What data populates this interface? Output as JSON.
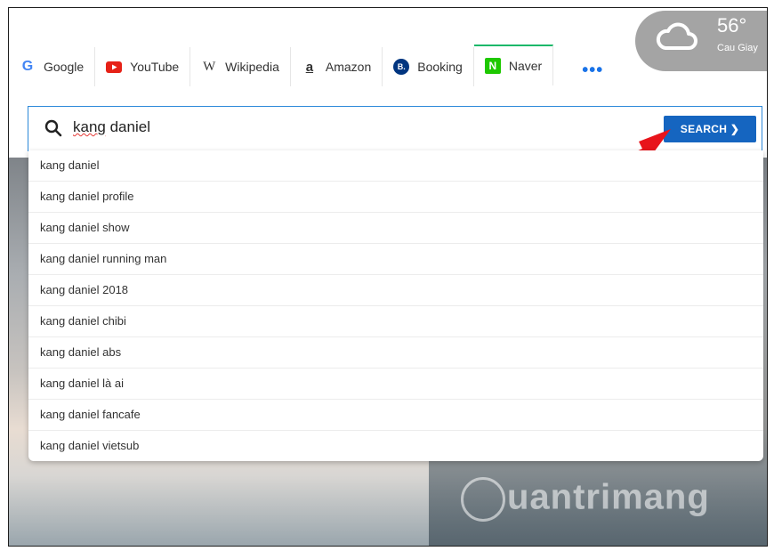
{
  "tabs": [
    {
      "label": "Google",
      "icon": "google-icon",
      "color": "#4285f4"
    },
    {
      "label": "YouTube",
      "icon": "youtube-icon",
      "color": "#e62117"
    },
    {
      "label": "Wikipedia",
      "icon": "wikipedia-icon",
      "color": "#333333"
    },
    {
      "label": "Amazon",
      "icon": "amazon-icon",
      "color": "#111111"
    },
    {
      "label": "Booking",
      "icon": "booking-icon",
      "color": "#003580"
    },
    {
      "label": "Naver",
      "icon": "naver-icon",
      "color": "#1ec800"
    }
  ],
  "tab_icon_glyphs": {
    "google": "G",
    "wikipedia": "W",
    "amazon": "a",
    "booking": "B.",
    "naver": "N"
  },
  "more_label": "•••",
  "weather": {
    "temp": "56°",
    "location": "Cau Giay",
    "icon": "cloud-icon"
  },
  "search": {
    "query_prefix": "",
    "query_squiggle": "kang",
    "query_rest": " daniel",
    "button_label": "SEARCH ❯"
  },
  "suggestions": [
    "kang daniel",
    "kang daniel profile",
    "kang daniel show",
    "kang daniel running man",
    "kang daniel 2018",
    "kang daniel chibi",
    "kang daniel abs",
    "kang daniel là ai",
    "kang daniel fancafe",
    "kang daniel vietsub"
  ],
  "watermark": "uantrimang",
  "colors": {
    "accent": "#1565c0",
    "arrow": "#e8141b",
    "active_tab": "#1cb86a"
  }
}
